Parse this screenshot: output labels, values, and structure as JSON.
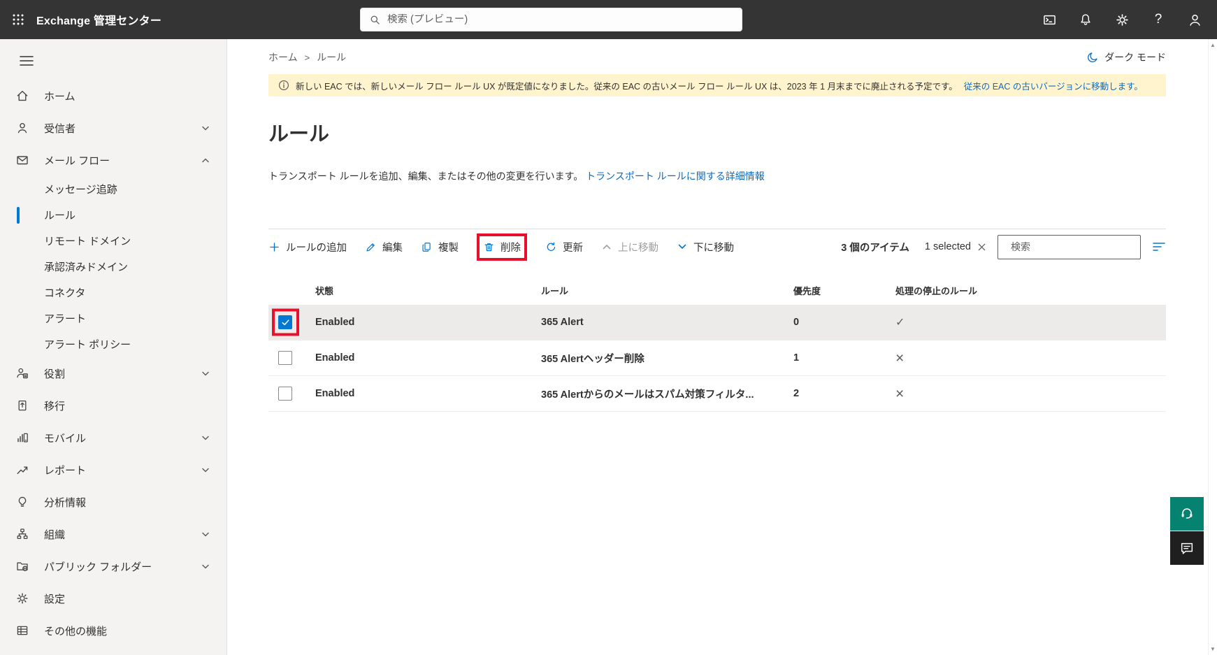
{
  "topbar": {
    "app_title": "Exchange 管理センター",
    "search_placeholder": "検索 (プレビュー)",
    "help_glyph": "?"
  },
  "sidebar": {
    "items": [
      {
        "label": "ホーム",
        "icon": "home"
      },
      {
        "label": "受信者",
        "icon": "person",
        "chevron": "down"
      },
      {
        "label": "メール フロー",
        "icon": "mail",
        "chevron": "up"
      },
      {
        "label": "メッセージ追跡",
        "sub": true
      },
      {
        "label": "ルール",
        "sub": true,
        "selected": true
      },
      {
        "label": "リモート ドメイン",
        "sub": true
      },
      {
        "label": "承認済みドメイン",
        "sub": true
      },
      {
        "label": "コネクタ",
        "sub": true
      },
      {
        "label": "アラート",
        "sub": true
      },
      {
        "label": "アラート ポリシー",
        "sub": true
      },
      {
        "label": "役割",
        "icon": "person-badge",
        "chevron": "down"
      },
      {
        "label": "移行",
        "icon": "document-arrow"
      },
      {
        "label": "モバイル",
        "icon": "mobile-chart",
        "chevron": "down"
      },
      {
        "label": "レポート",
        "icon": "line-chart",
        "chevron": "down"
      },
      {
        "label": "分析情報",
        "icon": "lightbulb"
      },
      {
        "label": "組織",
        "icon": "org-chart",
        "chevron": "down"
      },
      {
        "label": "パブリック フォルダー",
        "icon": "folder-globe",
        "chevron": "down"
      },
      {
        "label": "設定",
        "icon": "gear"
      },
      {
        "label": "その他の機能",
        "icon": "table-grid"
      }
    ]
  },
  "breadcrumb": {
    "items": [
      "ホーム",
      "ルール"
    ],
    "separator": ">"
  },
  "dark_mode_label": "ダーク モード",
  "banner": {
    "text": "新しい EAC では、新しいメール フロー ルール UX が既定値になりました。従来の EAC の古いメール フロー ルール UX は、2023 年 1 月末までに廃止される予定です。",
    "link": "従来の EAC の古いバージョンに移動します。"
  },
  "page": {
    "title": "ルール",
    "description": "トランスポート ルールを追加、編集、またはその他の変更を行います。",
    "description_link": "トランスポート ルールに関する詳細情報"
  },
  "toolbar": {
    "add_label": "ルールの追加",
    "edit_label": "編集",
    "duplicate_label": "複製",
    "delete_label": "削除",
    "refresh_label": "更新",
    "move_up_label": "上に移動",
    "move_down_label": "下に移動",
    "items_count": "3 個のアイテム",
    "selected_count": "1 selected",
    "search_placeholder": "検索"
  },
  "table": {
    "headers": {
      "status": "状態",
      "rule": "ルール",
      "priority": "優先度",
      "stop_processing": "処理の停止のルール"
    },
    "rows": [
      {
        "status": "Enabled",
        "rule": "365 Alert",
        "priority": "0",
        "stop_glyph": "✓",
        "checked": true,
        "selected": true
      },
      {
        "status": "Enabled",
        "rule": "365 Alertヘッダー削除",
        "priority": "1",
        "stop_glyph": "×",
        "checked": false
      },
      {
        "status": "Enabled",
        "rule": "365 Alertからのメールはスパム対策フィルタ...",
        "priority": "2",
        "stop_glyph": "×",
        "checked": false
      }
    ]
  },
  "colors": {
    "accent": "#0078d4",
    "topbar_bg": "#343434",
    "banner_bg": "#fff4ce",
    "selected_row_bg": "#edebe9",
    "annotation_red": "#e8112d",
    "support_teal": "#068271",
    "link_blue": "#0b6bc2"
  }
}
